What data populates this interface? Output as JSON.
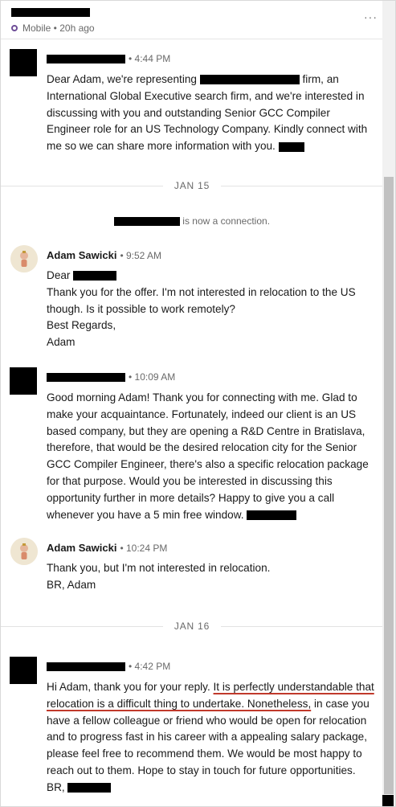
{
  "header": {
    "status": "Mobile • 20h ago",
    "more": "···"
  },
  "messages": [
    {
      "time": "• 4:44 PM",
      "parts": [
        "Dear Adam, we're representing ",
        " firm, an International Global Executive search firm, and we're interested in discussing with you and outstanding Senior GCC Compiler Engineer role for an US Technology Company. Kindly connect with me so we can share more information with you. "
      ]
    },
    {
      "author": "Adam Sawicki",
      "time": "• 9:52 AM",
      "lines": [
        "Dear ",
        "Thank you for the offer. I'm not interested in relocation to the US though. Is it possible to work remotely?",
        "Best Regards,",
        "Adam"
      ]
    },
    {
      "time": "• 10:09 AM",
      "text": "Good morning Adam! Thank you for connecting with me. Glad to make your acquaintance. Fortunately, indeed our client is an US based company, but they are opening a R&D Centre in Bratislava, therefore, that would be the desired relocation city for the Senior GCC Compiler Engineer, there's also a specific relocation package for that purpose.  Would you be interested in discussing this opportunity further in more details? Happy to give you a call whenever you have a 5 min free window. "
    },
    {
      "author": "Adam Sawicki",
      "time": "• 10:24 PM",
      "lines": [
        "Thank you, but I'm not interested in relocation.",
        "BR, Adam"
      ]
    },
    {
      "time": "• 4:42 PM",
      "pre": "Hi Adam, thank you for your reply. ",
      "highlight": "It is perfectly understandable that relocation is a difficult thing to undertake. Nonetheless,",
      "post": " in case you have a fellow colleague or friend who would be open for relocation and to progress fast in his career with a appealing salary package, please feel free to recommend them. We would be most happy to reach out to them. Hope to stay in touch for future opportunities. BR, "
    }
  ],
  "separators": {
    "first": "JAN 15",
    "second": "JAN 16"
  },
  "event": {
    "connection_text": "is now a connection."
  },
  "colors": {
    "underline": "#c0392b",
    "status_ring": "#6e4d97"
  }
}
